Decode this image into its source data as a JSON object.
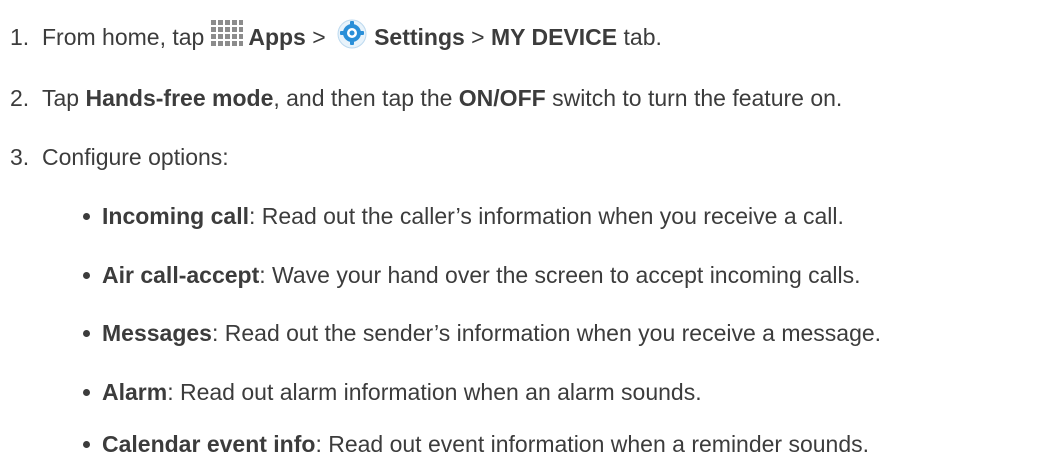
{
  "steps": [
    {
      "num": "1.",
      "t1": "From home, tap",
      "icon1": "apps-grid-icon",
      "b1": "Apps",
      "t2": " > ",
      "icon2": "settings-gear-icon",
      "b2": "Settings",
      "t3": " > ",
      "b3": "MY DEVICE",
      "t4": " tab."
    },
    {
      "num": "2.",
      "t1": "Tap ",
      "b1": "Hands-free mode",
      "t2": ", and then tap the ",
      "b2": "ON/OFF",
      "t3": " switch to turn the feature on."
    },
    {
      "num": "3.",
      "t1": "Configure options:"
    }
  ],
  "options": [
    {
      "name": "Incoming call",
      "desc": ": Read out the caller’s information when you receive a call."
    },
    {
      "name": "Air call-accept",
      "desc": ": Wave your hand over the screen to accept incoming calls."
    },
    {
      "name": "Messages",
      "desc": ": Read out the sender’s information when you receive a message."
    },
    {
      "name": "Alarm",
      "desc": ": Read out alarm information when an alarm sounds."
    },
    {
      "name": "Calendar event info",
      "desc": ": Read out event information when a reminder sounds."
    }
  ],
  "colors": {
    "text": "#3c3c3c",
    "gear_blue": "#2a8fd8",
    "grid": "#8c8c8c"
  }
}
